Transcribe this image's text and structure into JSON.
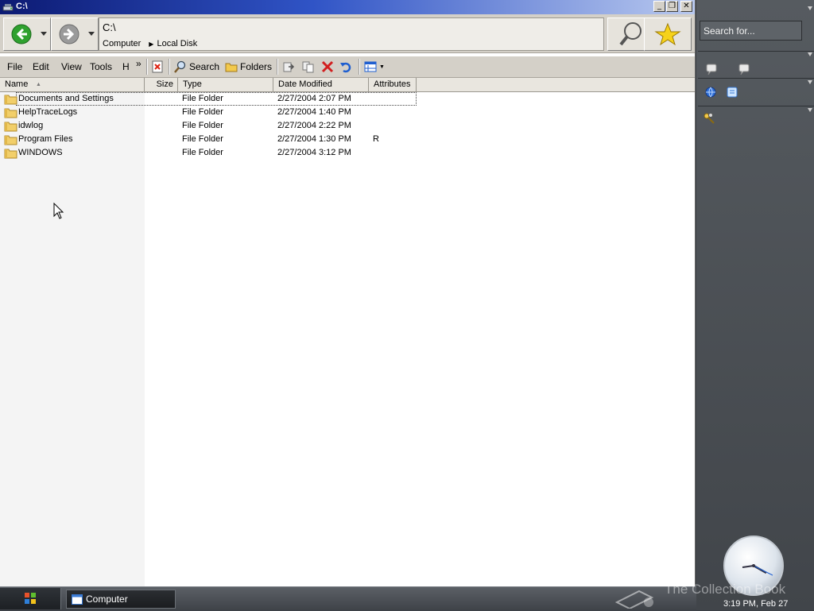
{
  "window": {
    "title": "C:\\"
  },
  "address": {
    "path": "C:\\",
    "crumbs": [
      "Computer",
      "Local Disk"
    ]
  },
  "menu": {
    "file": "File",
    "edit": "Edit",
    "view": "View",
    "tools": "Tools",
    "help": "H",
    "more": "»"
  },
  "toolbar": {
    "search_label": "Search",
    "folders_label": "Folders"
  },
  "columns": [
    "Name",
    "Size",
    "Type",
    "Date Modified",
    "Attributes"
  ],
  "files": [
    {
      "name": "Documents and Settings",
      "size": "",
      "type": "File Folder",
      "date": "2/27/2004 2:07 PM",
      "attr": ""
    },
    {
      "name": "HelpTraceLogs",
      "size": "",
      "type": "File Folder",
      "date": "2/27/2004 1:40 PM",
      "attr": ""
    },
    {
      "name": "idwlog",
      "size": "",
      "type": "File Folder",
      "date": "2/27/2004 2:22 PM",
      "attr": ""
    },
    {
      "name": "Program Files",
      "size": "",
      "type": "File Folder",
      "date": "2/27/2004 1:30 PM",
      "attr": "R"
    },
    {
      "name": "WINDOWS",
      "size": "",
      "type": "File Folder",
      "date": "2/27/2004 3:12 PM",
      "attr": ""
    }
  ],
  "sidebar": {
    "search_placeholder": "Search for...",
    "clock_label": "3:19 PM, Feb 27"
  },
  "taskbar": {
    "task_label": "Computer",
    "watermark": "The Collection Book"
  },
  "colors": {
    "title_gradient_start": "#0c1a73",
    "chrome": "#d4d0c8",
    "sidebar": "#41454a",
    "back_green": "#2fa12f"
  }
}
